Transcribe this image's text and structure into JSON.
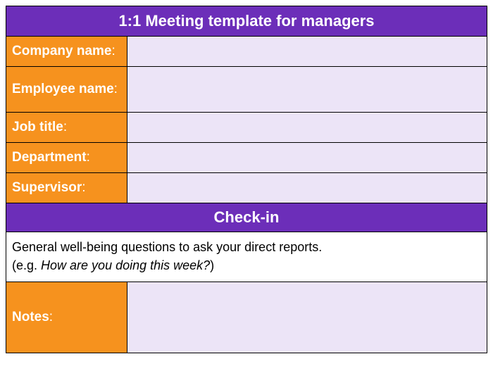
{
  "header": {
    "title": "1:1 Meeting template for managers"
  },
  "fields": {
    "company_name": {
      "label": "Company name",
      "value": ""
    },
    "employee_name": {
      "label": "Employee name",
      "value": ""
    },
    "job_title": {
      "label": "Job title",
      "value": ""
    },
    "department": {
      "label": "Department",
      "value": ""
    },
    "supervisor": {
      "label": "Supervisor",
      "value": ""
    }
  },
  "checkin": {
    "heading": "Check-in",
    "description_line1": "General well-being questions to ask your direct reports.",
    "description_prefix": "(e.g. ",
    "description_example": "How are you doing this week?",
    "description_suffix": ")",
    "notes_label": "Notes",
    "notes_value": ""
  }
}
